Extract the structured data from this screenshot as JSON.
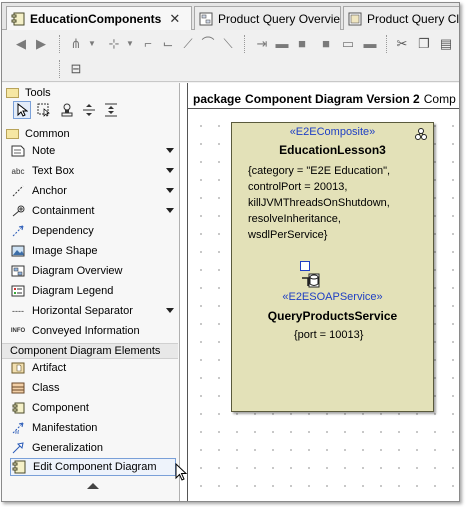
{
  "tabs": [
    {
      "label": "EducationComponents",
      "active": true,
      "close": "✕"
    },
    {
      "label": "Product Query Overview",
      "active": false
    },
    {
      "label": "Product Query Cla",
      "active": false
    }
  ],
  "palette": {
    "tools_header": "Tools",
    "common_header": "Common",
    "common_items": [
      {
        "label": "Note",
        "icon": "note-icon",
        "has_menu": true
      },
      {
        "label": "Text Box",
        "icon": "text-box-icon",
        "icon_text": "abc",
        "has_menu": true
      },
      {
        "label": "Anchor",
        "icon": "anchor-icon",
        "has_menu": true
      },
      {
        "label": "Containment",
        "icon": "containment-icon",
        "has_menu": true
      },
      {
        "label": "Dependency",
        "icon": "dependency-icon",
        "has_menu": false
      },
      {
        "label": "Image Shape",
        "icon": "image-shape-icon",
        "has_menu": false
      },
      {
        "label": "Diagram Overview",
        "icon": "diagram-overview-icon",
        "has_menu": false
      },
      {
        "label": "Diagram Legend",
        "icon": "diagram-legend-icon",
        "has_menu": false
      },
      {
        "label": "Horizontal Separator",
        "icon": "horizontal-separator-icon",
        "icon_text": "----",
        "has_menu": true
      },
      {
        "label": "Conveyed Information",
        "icon": "conveyed-information-icon",
        "icon_text": "INFO",
        "has_menu": false
      }
    ],
    "component_section": "Component Diagram Elements",
    "component_items": [
      {
        "label": "Artifact",
        "icon": "artifact-icon"
      },
      {
        "label": "Class",
        "icon": "class-icon"
      },
      {
        "label": "Component",
        "icon": "component-icon"
      },
      {
        "label": "Manifestation",
        "icon": "manifestation-icon"
      },
      {
        "label": "Generalization",
        "icon": "generalization-icon"
      },
      {
        "label": "Edit Component Diagram",
        "icon": "edit-component-diagram-icon",
        "selected": true
      }
    ]
  },
  "diagram": {
    "frame_keyword": "package",
    "frame_name": "Component Diagram Version 2",
    "frame_rest": "Comp"
  },
  "component": {
    "stereotype": "«E2EComposite»",
    "name": "EducationLesson3",
    "properties": [
      "{category = \"E2E Education\",",
      "controlPort = 20013,",
      "killJVMThreadsOnShutdown,",
      "resolveInheritance,",
      "wsdlPerService}"
    ],
    "service_stereotype": "«E2ESOAPService»",
    "service_name": "QueryProductsService",
    "service_property": "{port = 10013}"
  },
  "colors": {
    "component_fill": "#e3e1b8",
    "stereotype_blue": "#1f3fc4",
    "selection_border": "#7aa0d8"
  }
}
